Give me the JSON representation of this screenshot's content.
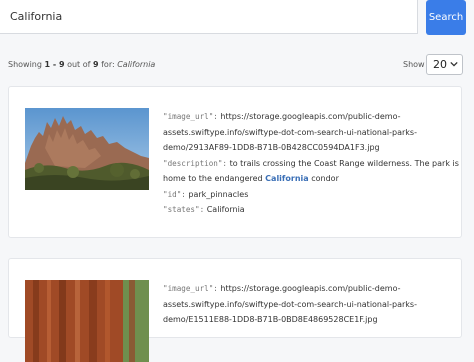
{
  "search": {
    "query": "California",
    "button_label": "Search"
  },
  "paging": {
    "prefix": "Showing ",
    "range": "1 - 9",
    "middle": " out of ",
    "total": "9",
    "for_label": " for: ",
    "term": "California",
    "show_label": "Show",
    "per_page": "20"
  },
  "results": [
    {
      "image_url_key": "\"image_url\":",
      "image_url_value": "https://storage.googleapis.com/public-demo-assets.swiftype.info/swiftype-dot-com-search-ui-national-parks-demo/2913AF89-1DD8-B71B-0B428CC0594DA1F3.jpg",
      "description_key": "\"description\":",
      "description_before": "to trails crossing the Coast Range wilderness. The park is home to the endangered ",
      "description_highlight": "California",
      "description_after": " condor",
      "id_key": "\"id\":",
      "id_value": "park_pinnacles",
      "states_key": "\"states\":",
      "states_value": "California"
    },
    {
      "image_url_key": "\"image_url\":",
      "image_url_value": "https://storage.googleapis.com/public-demo-assets.swiftype.info/swiftype-dot-com-search-ui-national-parks-demo/E1511E88-1DD8-B71B-0BD8E4869528CE1F.jpg"
    }
  ],
  "colors": {
    "accent": "#3a7de8",
    "highlight": "#3a6fb6",
    "background": "#f6f7f9"
  }
}
